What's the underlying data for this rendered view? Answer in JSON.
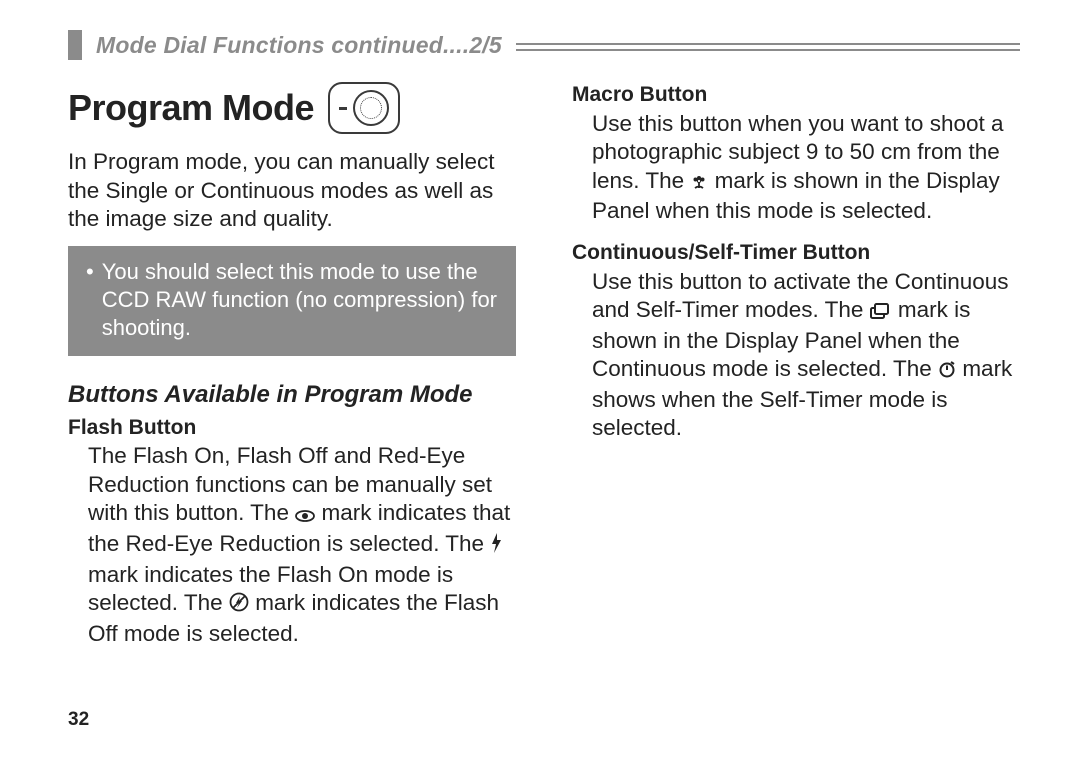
{
  "header": {
    "section_title": "Mode Dial Functions  continued....2/5"
  },
  "left": {
    "h1": "Program Mode",
    "intro": "In Program mode, you can manually select the Single or Continuous modes as well as the image size and quality.",
    "note": "You should select this mode to use the CCD RAW function (no compres­sion) for shooting.",
    "sub_h2": "Buttons Available in Program Mode",
    "flash": {
      "title": "Flash Button",
      "p1": "The Flash On, Flash Off and Red-Eye Reduction functions can be manually set with this button. The ",
      "p2": " mark indicates that the Red-Eye Reduction is selected. The ",
      "p3": " mark indicates the Flash On mode is selected. The ",
      "p4": " mark indicates the Flash Off mode is selected."
    }
  },
  "right": {
    "macro": {
      "title": "Macro Button",
      "p1": "Use this button when you want to shoot a photographic subject 9 to 50 cm from the lens. The ",
      "p2": " mark is shown in the Display Panel when this mode is selected."
    },
    "cont": {
      "title": "Continuous/Self-Timer Button",
      "p1": "Use this button to activate the Continuous and Self-Timer modes. The ",
      "p2": " mark is shown in the Display Panel when the Continuous mode is selected. The ",
      "p3": " mark shows when the Self-Timer mode is selected."
    }
  },
  "page_number": "32"
}
